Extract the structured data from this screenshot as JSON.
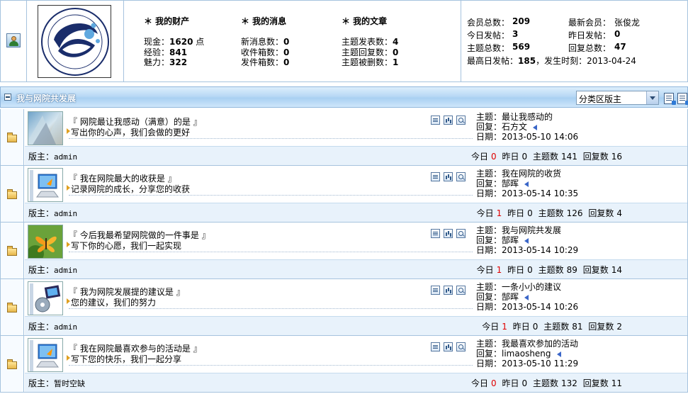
{
  "assets": {
    "title": "＊ 我的财产",
    "items": [
      {
        "label": "现金：",
        "value": "1620",
        "unit": " 点"
      },
      {
        "label": "经验：",
        "value": "841",
        "unit": ""
      },
      {
        "label": "魅力：",
        "value": "322",
        "unit": ""
      }
    ]
  },
  "messages": {
    "title": "＊ 我的消息",
    "items": [
      {
        "label": "新消息数：",
        "value": "0"
      },
      {
        "label": "收件箱数：",
        "value": "0"
      },
      {
        "label": "发件箱数：",
        "value": "0"
      }
    ]
  },
  "articles": {
    "title": "＊ 我的文章",
    "items": [
      {
        "label": "主题发表数：",
        "value": "4"
      },
      {
        "label": "主题回复数：",
        "value": "0"
      },
      {
        "label": "主题被删数：",
        "value": "1"
      }
    ]
  },
  "site_stats": {
    "left": [
      {
        "label": "会员总数：",
        "value": "209"
      },
      {
        "label": "今日发帖：",
        "value": "3"
      },
      {
        "label": "主题总数：",
        "value": "569"
      }
    ],
    "right": [
      {
        "label": "最新会员：",
        "value": "张俊龙"
      },
      {
        "label": "昨日发帖：",
        "value": "0"
      },
      {
        "label": "回复总数：",
        "value": "47"
      }
    ],
    "peak_label": "最高日发帖：",
    "peak_value": "185",
    "peak_time_label": "，发生时刻：",
    "peak_time": "2013-04-24"
  },
  "category": {
    "title": "我与网院共发展",
    "moderator_select": "分类区版主"
  },
  "forums": [
    {
      "name": "『 网院最让我感动（满意）的是 』",
      "desc": "写出你的心声，我们会做的更好",
      "thumb": "pattern",
      "last": {
        "subject_label": "主题：",
        "subject": "最让我感动的",
        "reply_label": "回复：",
        "reply": "石方文",
        "date_label": "日期：",
        "date": "2013-05-10 14:06"
      },
      "moderator_label": "版主：",
      "moderator": "admin",
      "today_label": "今日",
      "today": "0",
      "today_highlight": true,
      "yesterday_label": "昨日",
      "yesterday": "0",
      "topics_label": "主题数",
      "topics": "141",
      "replies_label": "回复数",
      "replies": "16"
    },
    {
      "name": "『 我在网院最大的收获是 』",
      "desc": "记录网院的成长，分享您的收获",
      "thumb": "computer",
      "last": {
        "subject_label": "主题：",
        "subject": "我在网院的收货",
        "reply_label": "回复：",
        "reply": "郜晖",
        "date_label": "日期：",
        "date": "2013-05-14 10:35"
      },
      "moderator_label": "版主：",
      "moderator": "admin",
      "today_label": "今日",
      "today": "1",
      "today_highlight": true,
      "yesterday_label": "昨日",
      "yesterday": "0",
      "topics_label": "主题数",
      "topics": "126",
      "replies_label": "回复数",
      "replies": "4"
    },
    {
      "name": "『 今后我最希望网院做的一件事是 』",
      "desc": "写下你的心愿，我们一起实现",
      "thumb": "butterfly",
      "last": {
        "subject_label": "主题：",
        "subject": "我与网院共发展",
        "reply_label": "回复：",
        "reply": "郜晖",
        "date_label": "日期：",
        "date": "2013-05-14 10:29"
      },
      "moderator_label": "版主：",
      "moderator": "admin",
      "today_label": "今日",
      "today": "1",
      "today_highlight": true,
      "yesterday_label": "昨日",
      "yesterday": "0",
      "topics_label": "主题数",
      "topics": "89",
      "replies_label": "回复数",
      "replies": "14"
    },
    {
      "name": "『 我为网院发展提的建议是 』",
      "desc": "您的建议，我们的努力",
      "thumb": "media",
      "last": {
        "subject_label": "主题：",
        "subject": "一条小小的建议",
        "reply_label": "回复：",
        "reply": "郜晖",
        "date_label": "日期：",
        "date": "2013-05-14 10:26"
      },
      "moderator_label": "版主：",
      "moderator": "admin",
      "today_label": "今日",
      "today": "1",
      "today_highlight": true,
      "yesterday_label": "昨日",
      "yesterday": "0",
      "topics_label": "主题数",
      "topics": "81",
      "replies_label": "回复数",
      "replies": "2"
    },
    {
      "name": "『 我在网院最喜欢参与的活动是 』",
      "desc": "写下您的快乐，我们一起分享",
      "thumb": "computer",
      "last": {
        "subject_label": "主题：",
        "subject": "我最喜欢参加的活动",
        "reply_label": "回复：",
        "reply": "limaosheng",
        "date_label": "日期：",
        "date": "2013-05-10 11:29"
      },
      "moderator_label": "版主：",
      "moderator": "暂时空缺",
      "today_label": "今日",
      "today": "0",
      "today_highlight": true,
      "yesterday_label": "昨日",
      "yesterday": "0",
      "topics_label": "主题数",
      "topics": "132",
      "replies_label": "回复数",
      "replies": "11"
    }
  ],
  "colors": {
    "border": "#a6c3de",
    "header_bg": "#b9d9f5",
    "row_footer_bg": "#e8f2fb",
    "highlight_red": "#e00000"
  }
}
